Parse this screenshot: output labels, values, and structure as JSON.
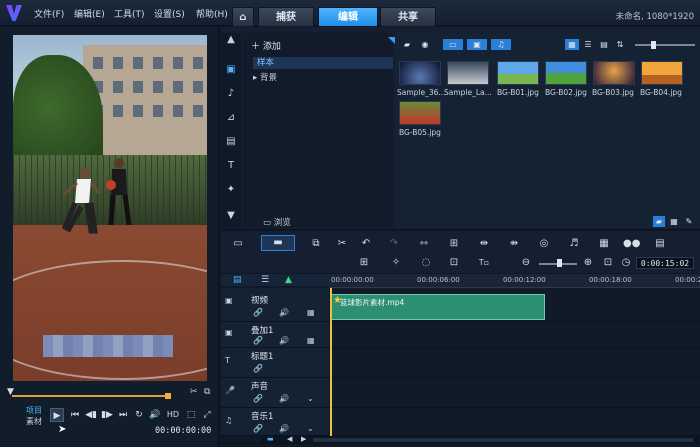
{
  "menu": {
    "file": "文件(F)",
    "edit": "编辑(E)",
    "tools": "工具(T)",
    "settings": "设置(S)",
    "help": "帮助(H)"
  },
  "tabs": {
    "capture": "捕获",
    "edit": "编辑",
    "share": "共享"
  },
  "project_info": "未命名, 1080*1920",
  "preview": {
    "mode_project": "项目",
    "mode_clip": "素材",
    "timecode": "00:00:00:00"
  },
  "library": {
    "add": "添加",
    "folders": [
      "样本",
      "背景"
    ],
    "browse": "浏览",
    "thumbnails": [
      "Sample_36...",
      "Sample_La...",
      "BG-B01.jpg",
      "BG-B02.jpg",
      "BG-B03.jpg",
      "BG-B04.jpg",
      "BG-B05.jpg"
    ]
  },
  "timeline": {
    "timecode": "0:00:15:02",
    "ruler": [
      "00:00:00:00",
      "00:00:06:00",
      "00:00:12:00",
      "00:00:18:00",
      "00:00:2"
    ],
    "tracks": [
      "视频",
      "叠加1",
      "标题1",
      "声音",
      "音乐1"
    ],
    "clip_label": "篮球影片素材.mp4"
  }
}
